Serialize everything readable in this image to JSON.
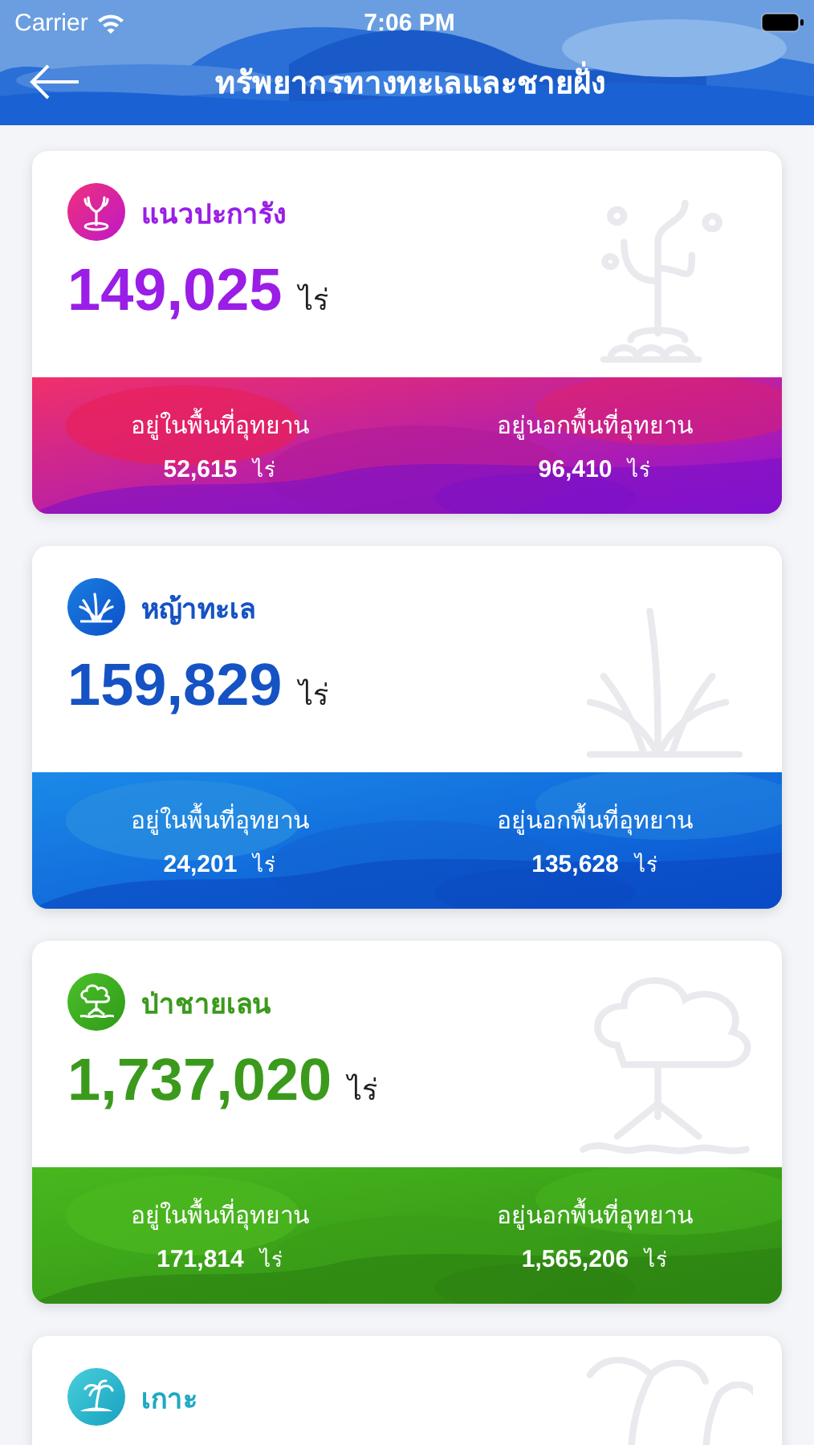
{
  "status_bar": {
    "carrier": "Carrier",
    "time": "7:06 PM"
  },
  "nav": {
    "title": "ทรัพยากรทางทะเลและชายฝั่ง"
  },
  "cards": [
    {
      "kind": "coral",
      "name": "แนวปะการัง",
      "total": "149,025",
      "unit": "ไร่",
      "stats": [
        {
          "label": "อยู่ในพื้นที่อุทยาน",
          "value": "52,615",
          "unit": "ไร่"
        },
        {
          "label": "อยู่นอกพื้นที่อุทยาน",
          "value": "96,410",
          "unit": "ไร่"
        }
      ]
    },
    {
      "kind": "seagrass",
      "name": "หญ้าทะเล",
      "total": "159,829",
      "unit": "ไร่",
      "stats": [
        {
          "label": "อยู่ในพื้นที่อุทยาน",
          "value": "24,201",
          "unit": "ไร่"
        },
        {
          "label": "อยู่นอกพื้นที่อุทยาน",
          "value": "135,628",
          "unit": "ไร่"
        }
      ]
    },
    {
      "kind": "mangrove",
      "name": "ป่าชายเลน",
      "total": "1,737,020",
      "unit": "ไร่",
      "stats": [
        {
          "label": "อยู่ในพื้นที่อุทยาน",
          "value": "171,814",
          "unit": "ไร่"
        },
        {
          "label": "อยู่นอกพื้นที่อุทยาน",
          "value": "1,565,206",
          "unit": "ไร่"
        }
      ]
    },
    {
      "kind": "island",
      "name": "เกาะ"
    }
  ]
}
